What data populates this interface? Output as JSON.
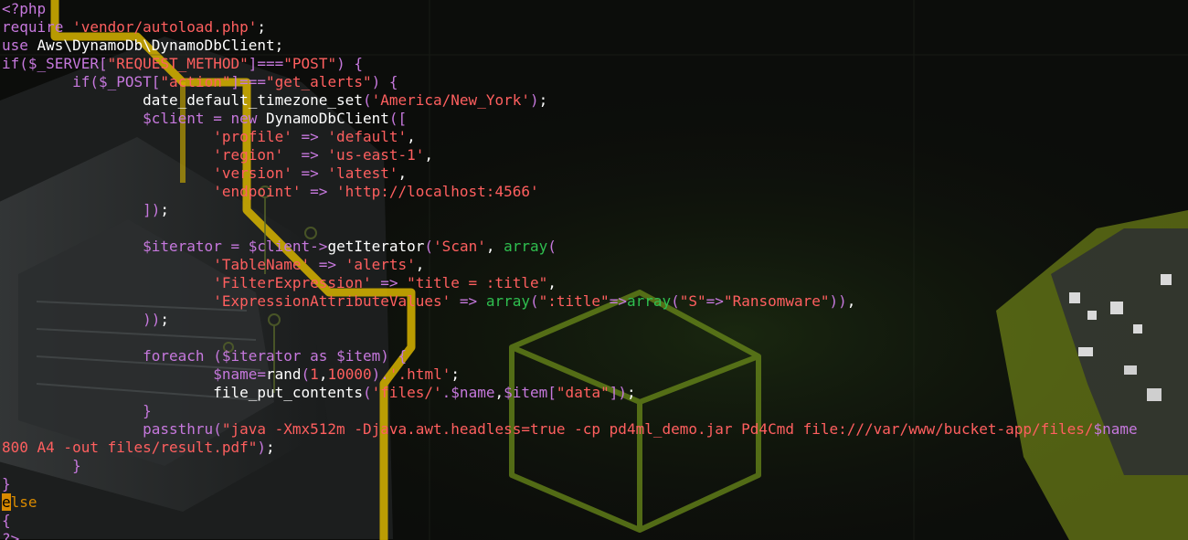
{
  "code_lines": [
    [
      {
        "t": "<?php",
        "c": "tag"
      }
    ],
    [
      {
        "t": "require ",
        "c": "kw"
      },
      {
        "t": "'vendor/autoload.php'",
        "c": "str"
      },
      {
        "t": ";",
        "c": "pl"
      }
    ],
    [
      {
        "t": "use ",
        "c": "kw"
      },
      {
        "t": "Aws\\DynamoDb\\DynamoDbClient",
        "c": "pl"
      },
      {
        "t": ";",
        "c": "pl"
      }
    ],
    [
      {
        "t": "if",
        "c": "kw"
      },
      {
        "t": "(",
        "c": "pun"
      },
      {
        "t": "$_SERVER",
        "c": "var"
      },
      {
        "t": "[",
        "c": "pun"
      },
      {
        "t": "\"REQUEST_METHOD\"",
        "c": "str"
      },
      {
        "t": "]",
        "c": "pun"
      },
      {
        "t": "===",
        "c": "pun"
      },
      {
        "t": "\"POST\"",
        "c": "str"
      },
      {
        "t": ") {",
        "c": "pun"
      }
    ],
    [
      {
        "t": "        ",
        "c": "pl"
      },
      {
        "t": "if",
        "c": "kw"
      },
      {
        "t": "(",
        "c": "pun"
      },
      {
        "t": "$_POST",
        "c": "var"
      },
      {
        "t": "[",
        "c": "pun"
      },
      {
        "t": "\"action\"",
        "c": "str"
      },
      {
        "t": "]",
        "c": "pun"
      },
      {
        "t": "===",
        "c": "pun"
      },
      {
        "t": "\"get_alerts\"",
        "c": "str"
      },
      {
        "t": ") {",
        "c": "pun"
      }
    ],
    [
      {
        "t": "                ",
        "c": "pl"
      },
      {
        "t": "date_default_timezone_set",
        "c": "pl"
      },
      {
        "t": "(",
        "c": "pun"
      },
      {
        "t": "'America/New_York'",
        "c": "str"
      },
      {
        "t": ")",
        "c": "pun"
      },
      {
        "t": ";",
        "c": "pl"
      }
    ],
    [
      {
        "t": "                ",
        "c": "pl"
      },
      {
        "t": "$client",
        "c": "var"
      },
      {
        "t": " = ",
        "c": "pun"
      },
      {
        "t": "new ",
        "c": "kw"
      },
      {
        "t": "DynamoDbClient",
        "c": "pl"
      },
      {
        "t": "([",
        "c": "pun"
      }
    ],
    [
      {
        "t": "                        ",
        "c": "pl"
      },
      {
        "t": "'profile'",
        "c": "str"
      },
      {
        "t": " => ",
        "c": "pun"
      },
      {
        "t": "'default'",
        "c": "str"
      },
      {
        "t": ",",
        "c": "pl"
      }
    ],
    [
      {
        "t": "                        ",
        "c": "pl"
      },
      {
        "t": "'region'",
        "c": "str"
      },
      {
        "t": "  => ",
        "c": "pun"
      },
      {
        "t": "'us-east-1'",
        "c": "str"
      },
      {
        "t": ",",
        "c": "pl"
      }
    ],
    [
      {
        "t": "                        ",
        "c": "pl"
      },
      {
        "t": "'version'",
        "c": "str"
      },
      {
        "t": " => ",
        "c": "pun"
      },
      {
        "t": "'latest'",
        "c": "str"
      },
      {
        "t": ",",
        "c": "pl"
      }
    ],
    [
      {
        "t": "                        ",
        "c": "pl"
      },
      {
        "t": "'endpoint'",
        "c": "str"
      },
      {
        "t": " => ",
        "c": "pun"
      },
      {
        "t": "'http://localhost:4566'",
        "c": "str"
      }
    ],
    [
      {
        "t": "                ",
        "c": "pl"
      },
      {
        "t": "])",
        "c": "pun"
      },
      {
        "t": ";",
        "c": "pl"
      }
    ],
    [],
    [
      {
        "t": "                ",
        "c": "pl"
      },
      {
        "t": "$iterator",
        "c": "var"
      },
      {
        "t": " = ",
        "c": "pun"
      },
      {
        "t": "$client",
        "c": "var"
      },
      {
        "t": "->",
        "c": "pun"
      },
      {
        "t": "getIterator",
        "c": "pl"
      },
      {
        "t": "(",
        "c": "pun"
      },
      {
        "t": "'Scan'",
        "c": "str"
      },
      {
        "t": ", ",
        "c": "pl"
      },
      {
        "t": "array",
        "c": "arr"
      },
      {
        "t": "(",
        "c": "pun"
      }
    ],
    [
      {
        "t": "                        ",
        "c": "pl"
      },
      {
        "t": "'TableName'",
        "c": "str"
      },
      {
        "t": " => ",
        "c": "pun"
      },
      {
        "t": "'alerts'",
        "c": "str"
      },
      {
        "t": ",",
        "c": "pl"
      }
    ],
    [
      {
        "t": "                        ",
        "c": "pl"
      },
      {
        "t": "'FilterExpression'",
        "c": "str"
      },
      {
        "t": " => ",
        "c": "pun"
      },
      {
        "t": "\"title = :title\"",
        "c": "str"
      },
      {
        "t": ",",
        "c": "pl"
      }
    ],
    [
      {
        "t": "                        ",
        "c": "pl"
      },
      {
        "t": "'ExpressionAttributeValues'",
        "c": "str"
      },
      {
        "t": " => ",
        "c": "pun"
      },
      {
        "t": "array",
        "c": "arr"
      },
      {
        "t": "(",
        "c": "pun"
      },
      {
        "t": "\":title\"",
        "c": "str"
      },
      {
        "t": "=>",
        "c": "pun"
      },
      {
        "t": "array",
        "c": "arr"
      },
      {
        "t": "(",
        "c": "pun"
      },
      {
        "t": "\"S\"",
        "c": "str"
      },
      {
        "t": "=>",
        "c": "pun"
      },
      {
        "t": "\"Ransomware\"",
        "c": "str"
      },
      {
        "t": "))",
        "c": "pun"
      },
      {
        "t": ",",
        "c": "pl"
      }
    ],
    [
      {
        "t": "                ",
        "c": "pl"
      },
      {
        "t": "))",
        "c": "pun"
      },
      {
        "t": ";",
        "c": "pl"
      }
    ],
    [],
    [
      {
        "t": "                ",
        "c": "pl"
      },
      {
        "t": "foreach",
        "c": "kw"
      },
      {
        "t": " (",
        "c": "pun"
      },
      {
        "t": "$iterator",
        "c": "var"
      },
      {
        "t": " as ",
        "c": "kw"
      },
      {
        "t": "$item",
        "c": "var"
      },
      {
        "t": ") {",
        "c": "pun"
      }
    ],
    [
      {
        "t": "                        ",
        "c": "pl"
      },
      {
        "t": "$name",
        "c": "var"
      },
      {
        "t": "=",
        "c": "pun"
      },
      {
        "t": "rand",
        "c": "pl"
      },
      {
        "t": "(",
        "c": "pun"
      },
      {
        "t": "1",
        "c": "str"
      },
      {
        "t": ",",
        "c": "pl"
      },
      {
        "t": "10000",
        "c": "str"
      },
      {
        "t": ")",
        "c": "pun"
      },
      {
        "t": ".",
        "c": "pun"
      },
      {
        "t": "'.html'",
        "c": "str"
      },
      {
        "t": ";",
        "c": "pl"
      }
    ],
    [
      {
        "t": "                        ",
        "c": "pl"
      },
      {
        "t": "file_put_contents",
        "c": "pl"
      },
      {
        "t": "(",
        "c": "pun"
      },
      {
        "t": "'files/'",
        "c": "str"
      },
      {
        "t": ".",
        "c": "pun"
      },
      {
        "t": "$name",
        "c": "var"
      },
      {
        "t": ",",
        "c": "pl"
      },
      {
        "t": "$item",
        "c": "var"
      },
      {
        "t": "[",
        "c": "pun"
      },
      {
        "t": "\"data\"",
        "c": "str"
      },
      {
        "t": "])",
        "c": "pun"
      },
      {
        "t": ";",
        "c": "pl"
      }
    ],
    [
      {
        "t": "                ",
        "c": "pl"
      },
      {
        "t": "}",
        "c": "pun"
      }
    ],
    [
      {
        "t": "                ",
        "c": "pl"
      },
      {
        "t": "passthru",
        "c": "kw"
      },
      {
        "t": "(",
        "c": "pun"
      },
      {
        "t": "\"java -Xmx512m -Djava.awt.headless=true -cp pd4ml_demo.jar Pd4Cmd file:///var/www/bucket-app/files/",
        "c": "str"
      },
      {
        "t": "$name",
        "c": "var"
      }
    ],
    [
      {
        "t": "800 A4 -out files/result.pdf\"",
        "c": "str"
      },
      {
        "t": ")",
        "c": "pun"
      },
      {
        "t": ";",
        "c": "pl"
      }
    ],
    [
      {
        "t": "        ",
        "c": "pl"
      },
      {
        "t": "}",
        "c": "pun"
      }
    ],
    [
      {
        "t": "}",
        "c": "pun"
      }
    ],
    [
      {
        "t": "e",
        "c": "cursor"
      },
      {
        "t": "lse",
        "c": "else"
      }
    ],
    [
      {
        "t": "{",
        "c": "pun"
      }
    ],
    [
      {
        "t": "?>",
        "c": "tag"
      }
    ]
  ],
  "colors": {
    "background": "#0b0c0a",
    "keyword": "#c678dd",
    "string": "#ff5f5f",
    "plain": "#ffffff",
    "array_fn": "#2fbf4f",
    "cursor": "#d98a00"
  }
}
